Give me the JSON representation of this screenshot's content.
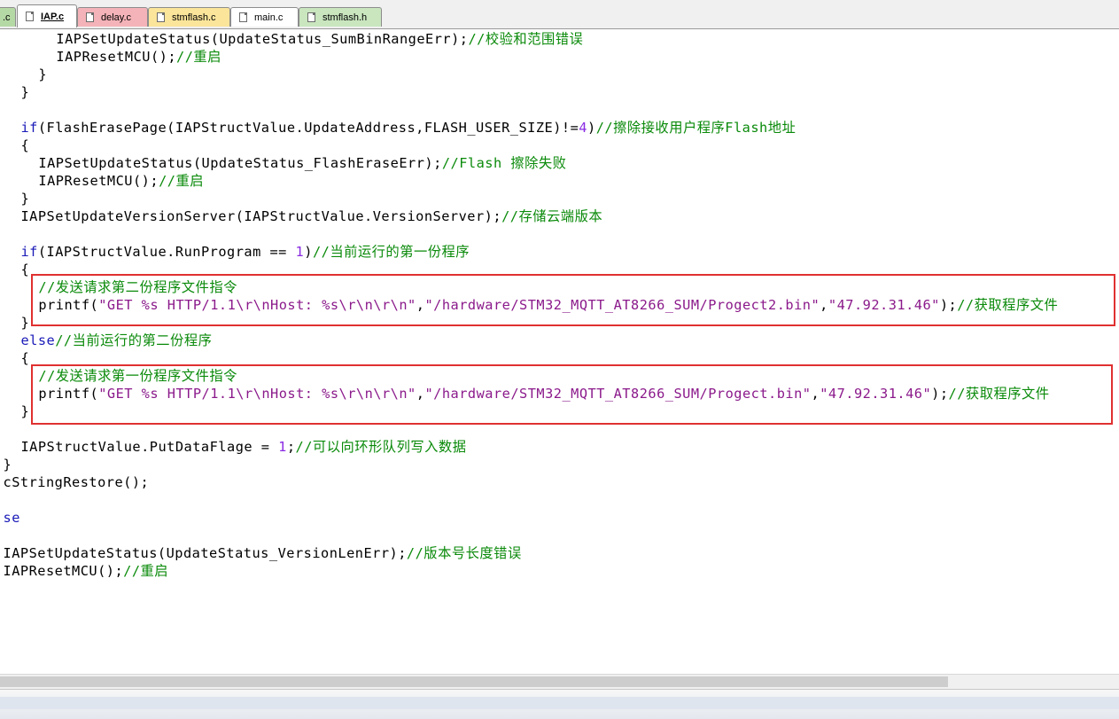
{
  "tabs": [
    {
      "label": ".c",
      "color": "#b5d9a5"
    },
    {
      "label": "IAP.c",
      "color": "#ffffff",
      "active": true
    },
    {
      "label": "delay.c",
      "color": "#f4b3b8"
    },
    {
      "label": "stmflash.c",
      "color": "#fbe59a"
    },
    {
      "label": "main.c",
      "color": "#ffffff"
    },
    {
      "label": "stmflash.h",
      "color": "#c9e6bf"
    }
  ],
  "editor": {
    "lines": [
      {
        "indent": 6,
        "tokens": [
          {
            "t": "IAPSetUpdateStatus(UpdateStatus_SumBinRangeErr);"
          },
          {
            "t": "//校验和范围错误",
            "c": "cm"
          }
        ]
      },
      {
        "indent": 6,
        "tokens": [
          {
            "t": "IAPResetMCU();"
          },
          {
            "t": "//重启",
            "c": "cm"
          }
        ]
      },
      {
        "indent": 4,
        "tokens": [
          {
            "t": "}"
          }
        ]
      },
      {
        "indent": 2,
        "tokens": [
          {
            "t": "}"
          }
        ]
      },
      {
        "indent": 0,
        "tokens": []
      },
      {
        "indent": 2,
        "tokens": [
          {
            "t": "if",
            "c": "kw"
          },
          {
            "t": "(FlashErasePage(IAPStructValue.UpdateAddress,FLASH_USER_SIZE)!="
          },
          {
            "t": "4",
            "c": "num"
          },
          {
            "t": ")"
          },
          {
            "t": "//擦除接收用户程序Flash地址",
            "c": "cm"
          }
        ]
      },
      {
        "indent": 2,
        "tokens": [
          {
            "t": "{"
          }
        ]
      },
      {
        "indent": 4,
        "tokens": [
          {
            "t": "IAPSetUpdateStatus(UpdateStatus_FlashEraseErr);"
          },
          {
            "t": "//Flash 擦除失败",
            "c": "cm"
          }
        ]
      },
      {
        "indent": 4,
        "tokens": [
          {
            "t": "IAPResetMCU();"
          },
          {
            "t": "//重启",
            "c": "cm"
          }
        ]
      },
      {
        "indent": 2,
        "tokens": [
          {
            "t": "}"
          }
        ]
      },
      {
        "indent": 2,
        "tokens": [
          {
            "t": "IAPSetUpdateVersionServer(IAPStructValue.VersionServer);"
          },
          {
            "t": "//存储云端版本",
            "c": "cm"
          }
        ]
      },
      {
        "indent": 0,
        "tokens": []
      },
      {
        "indent": 2,
        "tokens": [
          {
            "t": "if",
            "c": "kw"
          },
          {
            "t": "(IAPStructValue.RunProgram == "
          },
          {
            "t": "1",
            "c": "num"
          },
          {
            "t": ")"
          },
          {
            "t": "//当前运行的第一份程序",
            "c": "cm"
          }
        ]
      },
      {
        "indent": 2,
        "tokens": [
          {
            "t": "{"
          }
        ]
      },
      {
        "indent": 4,
        "tokens": [
          {
            "t": "//发送请求第二份程序文件指令",
            "c": "cm"
          }
        ]
      },
      {
        "indent": 4,
        "tokens": [
          {
            "t": "printf("
          },
          {
            "t": "\"GET %s HTTP/1.1\\r\\nHost: %s\\r\\n\\r\\n\"",
            "c": "str"
          },
          {
            "t": ","
          },
          {
            "t": "\"/hardware/STM32_MQTT_AT8266_SUM/Progect2.bin\"",
            "c": "str"
          },
          {
            "t": ","
          },
          {
            "t": "\"47.92.31.46\"",
            "c": "str"
          },
          {
            "t": ");"
          },
          {
            "t": "//获取程序文件",
            "c": "cm"
          }
        ]
      },
      {
        "indent": 2,
        "tokens": [
          {
            "t": "}"
          }
        ]
      },
      {
        "indent": 2,
        "tokens": [
          {
            "t": "else",
            "c": "kw"
          },
          {
            "t": "//当前运行的第二份程序",
            "c": "cm"
          }
        ]
      },
      {
        "indent": 2,
        "tokens": [
          {
            "t": "{"
          }
        ]
      },
      {
        "indent": 4,
        "tokens": [
          {
            "t": "//发送请求第一份程序文件指令",
            "c": "cm"
          }
        ]
      },
      {
        "indent": 4,
        "tokens": [
          {
            "t": "printf("
          },
          {
            "t": "\"GET %s HTTP/1.1\\r\\nHost: %s\\r\\n\\r\\n\"",
            "c": "str"
          },
          {
            "t": ","
          },
          {
            "t": "\"/hardware/STM32_MQTT_AT8266_SUM/Progect.bin\"",
            "c": "str"
          },
          {
            "t": ","
          },
          {
            "t": "\"47.92.31.46\"",
            "c": "str"
          },
          {
            "t": ");"
          },
          {
            "t": "//获取程序文件",
            "c": "cm"
          }
        ]
      },
      {
        "indent": 2,
        "tokens": [
          {
            "t": "}"
          }
        ]
      },
      {
        "indent": 0,
        "tokens": []
      },
      {
        "indent": 2,
        "tokens": [
          {
            "t": "IAPStructValue.PutDataFlage = "
          },
          {
            "t": "1",
            "c": "num"
          },
          {
            "t": ";"
          },
          {
            "t": "//可以向环形队列写入数据",
            "c": "cm"
          }
        ]
      },
      {
        "indent": 0,
        "tokens": [
          {
            "t": "}"
          }
        ]
      },
      {
        "indent": 0,
        "tokens": [
          {
            "t": "cStringRestore();"
          }
        ]
      },
      {
        "indent": 0,
        "tokens": []
      },
      {
        "indent": 0,
        "tokens": [
          {
            "t": "se",
            "c": "kw"
          }
        ]
      },
      {
        "indent": 0,
        "tokens": []
      },
      {
        "indent": 0,
        "tokens": [
          {
            "t": "IAPSetUpdateStatus(UpdateStatus_VersionLenErr);"
          },
          {
            "t": "//版本号长度错误",
            "c": "cm"
          }
        ]
      },
      {
        "indent": 0,
        "tokens": [
          {
            "t": "IAPResetMCU();"
          },
          {
            "t": "//重启",
            "c": "cm"
          }
        ]
      }
    ],
    "highlight_colors": {
      "box": "#e03030"
    }
  }
}
